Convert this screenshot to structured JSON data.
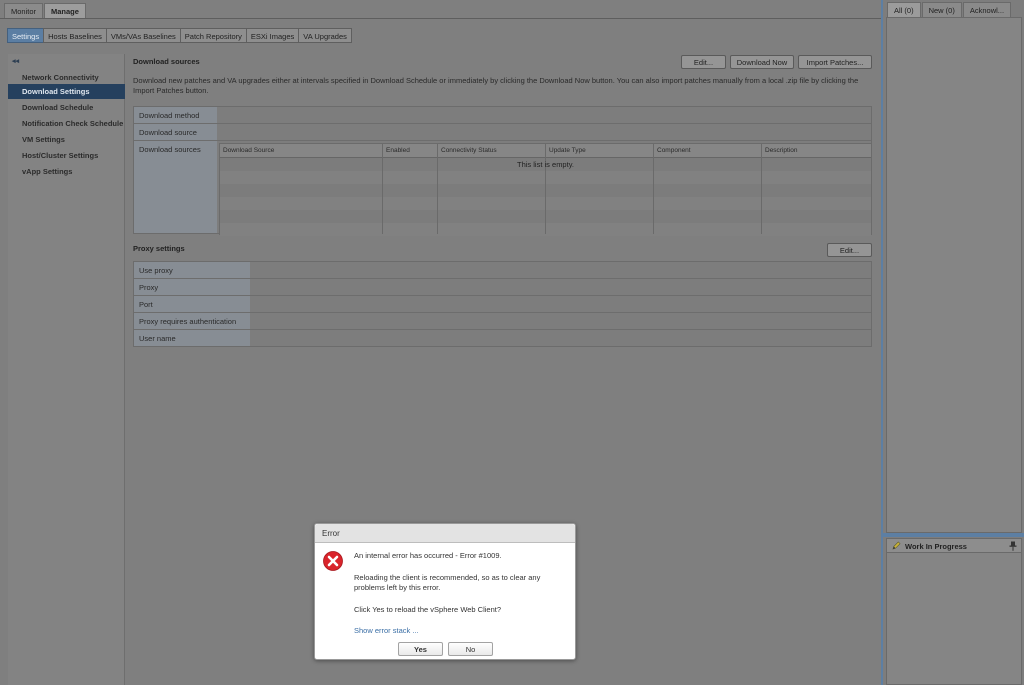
{
  "top_tabs": [
    {
      "label": "Monitor",
      "active": false
    },
    {
      "label": "Manage",
      "active": true
    }
  ],
  "sub_tabs": [
    "Settings",
    "Hosts Baselines",
    "VMs/VAs Baselines",
    "Patch Repository",
    "ESXi Images",
    "VA Upgrades"
  ],
  "nav": {
    "collapse_glyph": "◂◂",
    "items": [
      "Network Connectivity",
      "Download Settings",
      "Download Schedule",
      "Notification Check Schedule",
      "VM Settings",
      "Host/Cluster Settings",
      "vApp Settings"
    ],
    "active_index": 1
  },
  "download_sources": {
    "title": "Download sources",
    "buttons": {
      "edit": "Edit...",
      "download_now": "Download Now",
      "import_patches": "Import Patches..."
    },
    "description": "Download new patches and VA upgrades either at intervals specified in Download Schedule or immediately by clicking the Download Now button. You can also import patches manually from a local .zip file by clicking the Import Patches button.",
    "rows": [
      "Download method",
      "Download source",
      "Download sources"
    ],
    "grid": {
      "columns": [
        "Download Source",
        "Enabled",
        "Connectivity Status",
        "Update Type",
        "Component",
        "Description"
      ],
      "empty_text": "This list is empty."
    }
  },
  "proxy": {
    "title": "Proxy settings",
    "edit": "Edit...",
    "rows": [
      "Use proxy",
      "Proxy",
      "Port",
      "Proxy requires authentication",
      "User name"
    ]
  },
  "right_panel": {
    "tabs": [
      "All (0)",
      "New (0)",
      "Acknowl..."
    ],
    "work_in_progress": "Work In Progress",
    "accent": "#5d7fa3"
  },
  "dialog": {
    "title": "Error",
    "line1": "An internal error has occurred - Error #1009.",
    "line2a": "Reloading the client is recommended, so as to clear any",
    "line2b": "problems left by this error.",
    "line3": "Click Yes to reload the vSphere Web Client?",
    "link": "Show error stack ...",
    "yes": "Yes",
    "no": "No",
    "icon_color": "#d9242b"
  }
}
